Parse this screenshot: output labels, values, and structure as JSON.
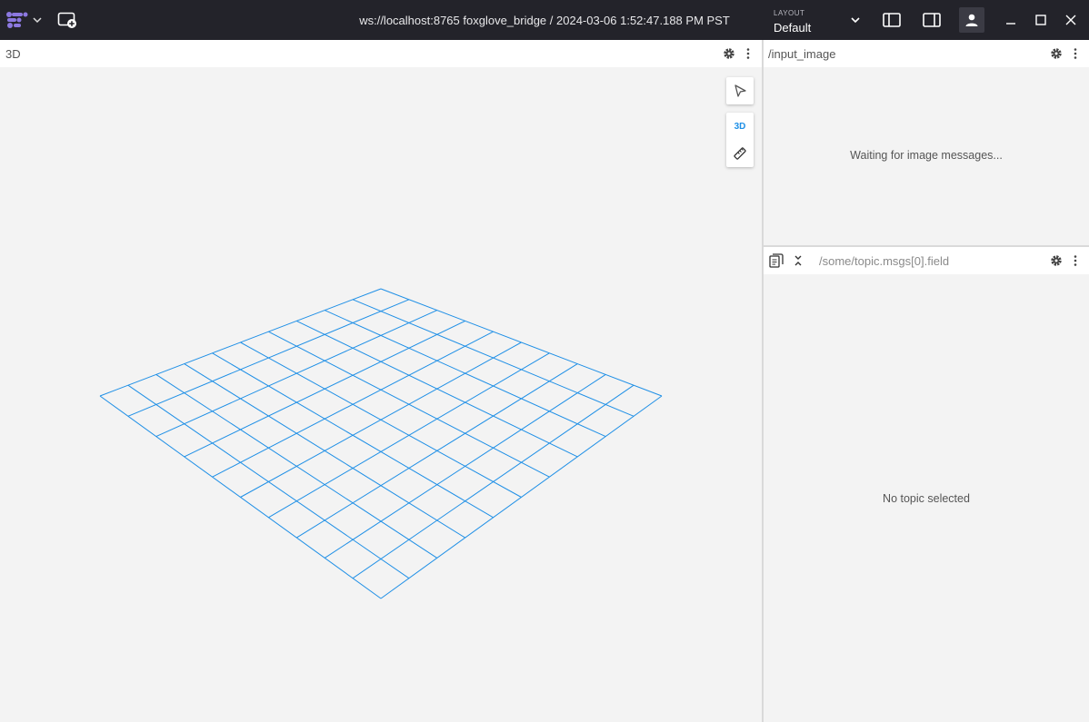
{
  "app": {
    "connection": "ws://localhost:8765 foxglove_bridge / 2024-03-06 1:52:47.188 PM PST",
    "layout_label": "LAYOUT",
    "layout_value": "Default"
  },
  "icons": {
    "app_logo": "foxglove-logo-icon",
    "add_panel": "add-panel-icon",
    "left_sidebar": "left-sidebar-icon",
    "right_sidebar": "right-sidebar-icon",
    "user": "user-icon",
    "minimize": "minimize-icon",
    "maximize": "maximize-icon",
    "close": "close-icon"
  },
  "panels": {
    "three_d": {
      "title": "3D",
      "tools": {
        "select": "cursor-icon",
        "mode_label": "3D",
        "measure": "ruler-icon"
      }
    },
    "image": {
      "title": "/input_image",
      "message": "Waiting for image messages..."
    },
    "raw": {
      "placeholder": "/some/topic.msgs[0].field",
      "message": "No topic selected"
    }
  },
  "colors": {
    "topbar": "#23232a",
    "grid": "#1e8fe6",
    "panel_bg": "#f3f3f3",
    "accent": "#8c78e0"
  }
}
